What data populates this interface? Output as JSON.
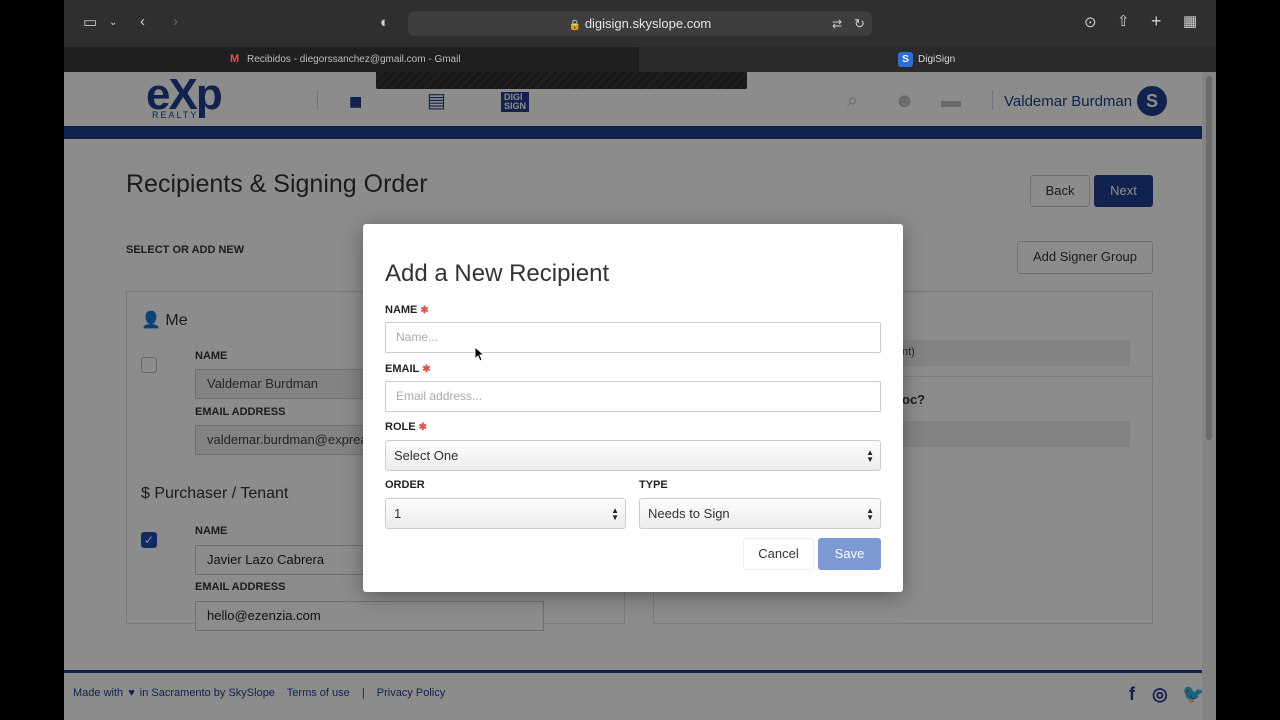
{
  "browser": {
    "url": "digisign.skyslope.com",
    "tabs": [
      {
        "label": "Recibidos - diegorssanchez@gmail.com - Gmail"
      },
      {
        "label": "DigiSign"
      }
    ]
  },
  "header": {
    "logo_main": "eXp",
    "logo_sub": "REALTY",
    "digi_label_1": "DIGI",
    "digi_label_2": "SIGN",
    "user_name": "Valdemar Burdman",
    "user_initial": "S"
  },
  "page": {
    "title": "Recipients & Signing Order",
    "back_label": "Back",
    "next_label": "Next",
    "select_add_label": "SELECT OR ADD NEW",
    "add_signer_group_label": "Add Signer Group",
    "me": {
      "role": "Me",
      "name_label": "NAME",
      "name_value": "Valdemar Burdman",
      "email_label": "EMAIL ADDRESS",
      "email_value": "valdemar.burdman@exprea"
    },
    "purchaser": {
      "role": "Purchaser / Tenant",
      "name_label": "NAME",
      "name_value": "Javier Lazo Cabrera",
      "email_label": "EMAIL ADDRESS",
      "email_value": "hello@ezenzia.com"
    },
    "right_panel": {
      "fragment_1": "nt)",
      "fragment_2": "oc?"
    }
  },
  "footer": {
    "made_with": "Made with",
    "heart": "♥",
    "made_in": "in Sacramento by SkySlope",
    "terms": "Terms of use",
    "sep": "|",
    "privacy": "Privacy Policy"
  },
  "modal": {
    "title": "Add a New Recipient",
    "name_label": "NAME",
    "name_placeholder": "Name...",
    "email_label": "EMAIL",
    "email_placeholder": "Email address...",
    "role_label": "ROLE",
    "role_value": "Select One",
    "order_label": "ORDER",
    "order_value": "1",
    "type_label": "TYPE",
    "type_value": "Needs to Sign",
    "cancel_label": "Cancel",
    "save_label": "Save",
    "required_mark": "✱"
  }
}
